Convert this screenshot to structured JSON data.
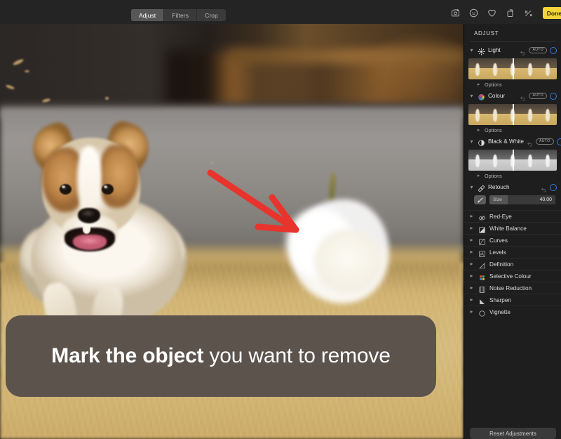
{
  "topbar": {
    "tabs": [
      {
        "label": "Adjust",
        "active": true
      },
      {
        "label": "Filters",
        "active": false
      },
      {
        "label": "Crop",
        "active": false
      }
    ],
    "icons": [
      {
        "name": "markup-icon",
        "glyph": "markup"
      },
      {
        "name": "info-icon",
        "glyph": "info"
      },
      {
        "name": "favorite-heart-icon",
        "glyph": "heart"
      },
      {
        "name": "rotate-icon",
        "glyph": "rotate"
      },
      {
        "name": "magic-wand-icon",
        "glyph": "wand"
      }
    ],
    "done_label": "Done"
  },
  "canvas": {
    "annotation_arrow": {
      "name": "red-arrow",
      "color": "#e8342c"
    },
    "retouch_mask": {
      "name": "retouch-mask-blob",
      "color": "#ffffff"
    },
    "caption": {
      "bold_text": "Mark the object",
      "rest_text": " you want to remove",
      "background": "#5c534c",
      "text_color": "#ffffff"
    }
  },
  "sidebar": {
    "title": "ADJUST",
    "accent": "#2f7de1",
    "auto_badge": "AUTO",
    "options_label": "Options",
    "expanded": [
      {
        "name": "light",
        "label": "Light",
        "icon": "sun-icon",
        "has_auto": true,
        "has_filmstrip": true,
        "filmstrip_mode": "colour",
        "has_options": true
      },
      {
        "name": "colour",
        "label": "Colour",
        "icon": "colour-wheel-icon",
        "has_auto": true,
        "has_filmstrip": true,
        "filmstrip_mode": "colour",
        "has_options": true
      },
      {
        "name": "black-and-white",
        "label": "Black & White",
        "icon": "contrast-circle-icon",
        "has_auto": true,
        "has_filmstrip": true,
        "filmstrip_mode": "bw",
        "has_options": true
      }
    ],
    "retouch": {
      "label": "Retouch",
      "icon": "bandage-icon",
      "brush_icon": "brush-icon",
      "size_label": "Size",
      "size_value": "40.00",
      "size_percent": 28
    },
    "collapsed": [
      {
        "name": "red-eye",
        "label": "Red-Eye",
        "icon": "eye-icon"
      },
      {
        "name": "white-balance",
        "label": "White Balance",
        "icon": "white-balance-icon"
      },
      {
        "name": "curves",
        "label": "Curves",
        "icon": "curves-icon"
      },
      {
        "name": "levels",
        "label": "Levels",
        "icon": "levels-icon"
      },
      {
        "name": "definition",
        "label": "Definition",
        "icon": "definition-icon"
      },
      {
        "name": "selective-colour",
        "label": "Selective Colour",
        "icon": "selective-colour-icon"
      },
      {
        "name": "noise-reduction",
        "label": "Noise Reduction",
        "icon": "noise-reduction-icon"
      },
      {
        "name": "sharpen",
        "label": "Sharpen",
        "icon": "sharpen-icon"
      },
      {
        "name": "vignette",
        "label": "Vignette",
        "icon": "vignette-icon"
      }
    ],
    "reset_label": "Reset Adjustments"
  }
}
